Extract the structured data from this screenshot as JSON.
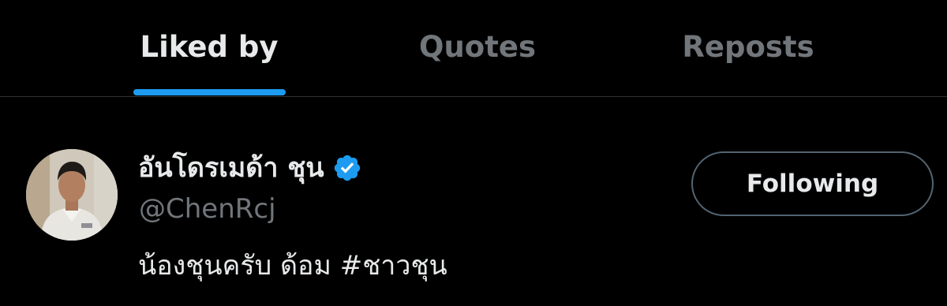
{
  "tabs": [
    {
      "label": "Liked by",
      "active": true
    },
    {
      "label": "Quotes",
      "active": false
    },
    {
      "label": "Reposts",
      "active": false
    }
  ],
  "colors": {
    "background": "#000000",
    "accent": "#1d9bf0",
    "text_primary": "#e7e9ea",
    "text_secondary": "#71767b",
    "divider": "#2f3336"
  },
  "user": {
    "display_name": "อันโดรเมด้า ชุน",
    "verified": true,
    "verified_icon": "verified-badge-icon",
    "handle": "@ChenRcj",
    "bio_text": "น้องชุนครับ ด้อม ",
    "bio_hashtag": "#ชาวชุน",
    "follow_button_label": "Following"
  }
}
